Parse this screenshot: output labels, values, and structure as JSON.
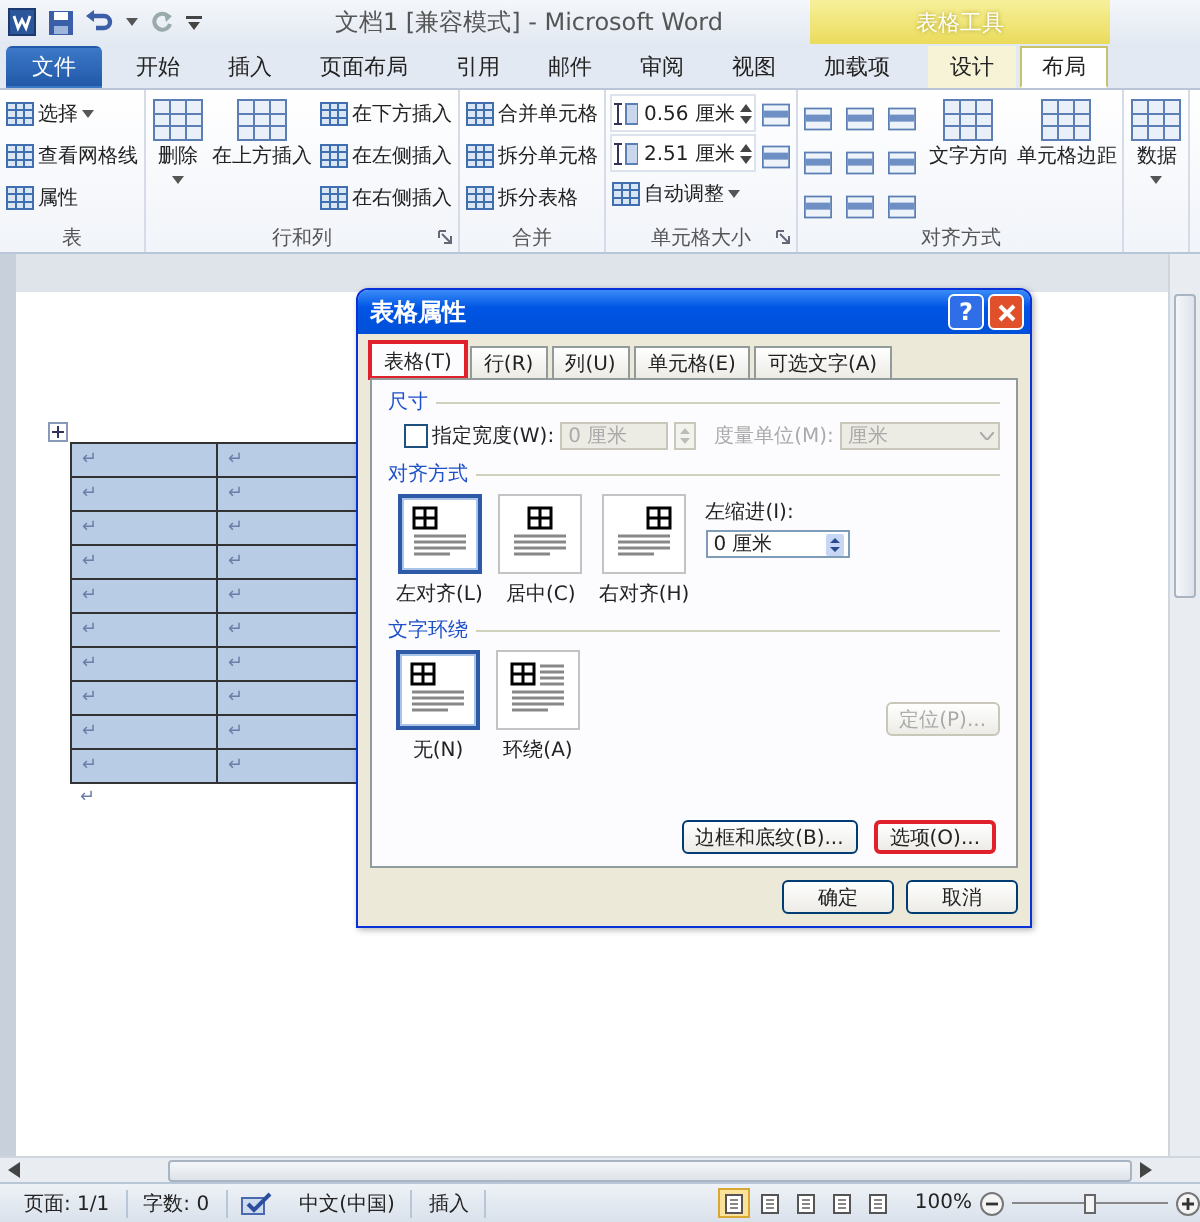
{
  "window": {
    "title": "文档1 [兼容模式] - Microsoft Word",
    "contextual_label": "表格工具"
  },
  "ribbon_tabs": [
    {
      "label": "文件",
      "kind": "file",
      "selected": false
    },
    {
      "label": "开始",
      "kind": "normal",
      "selected": false
    },
    {
      "label": "插入",
      "kind": "normal",
      "selected": false
    },
    {
      "label": "页面布局",
      "kind": "normal",
      "selected": false
    },
    {
      "label": "引用",
      "kind": "normal",
      "selected": false
    },
    {
      "label": "邮件",
      "kind": "normal",
      "selected": false
    },
    {
      "label": "审阅",
      "kind": "normal",
      "selected": false
    },
    {
      "label": "视图",
      "kind": "normal",
      "selected": false
    },
    {
      "label": "加载项",
      "kind": "normal",
      "selected": false
    },
    {
      "label": "设计",
      "kind": "contextual",
      "selected": false
    },
    {
      "label": "布局",
      "kind": "contextual",
      "selected": true
    }
  ],
  "ribbon_groups": [
    {
      "title": "表",
      "columns": [
        {
          "kind": "stack",
          "items": [
            {
              "kind": "small",
              "label": "选择",
              "dropdown": true
            },
            {
              "kind": "small",
              "label": "查看网格线"
            },
            {
              "kind": "small",
              "label": "属性"
            }
          ]
        }
      ]
    },
    {
      "title": "行和列",
      "launcher": true,
      "columns": [
        {
          "kind": "stack",
          "items": [
            {
              "kind": "large",
              "label": "删除",
              "dropdown": true
            }
          ]
        },
        {
          "kind": "stack",
          "items": [
            {
              "kind": "large",
              "label": "在上方插入"
            }
          ]
        },
        {
          "kind": "stack",
          "items": [
            {
              "kind": "small",
              "label": "在下方插入"
            },
            {
              "kind": "small",
              "label": "在左侧插入"
            },
            {
              "kind": "small",
              "label": "在右侧插入"
            }
          ]
        }
      ]
    },
    {
      "title": "合并",
      "columns": [
        {
          "kind": "stack",
          "items": [
            {
              "kind": "small",
              "label": "合并单元格"
            },
            {
              "kind": "small",
              "label": "拆分单元格"
            },
            {
              "kind": "small",
              "label": "拆分表格"
            }
          ]
        }
      ]
    },
    {
      "title": "单元格大小",
      "launcher": true,
      "columns": [
        {
          "kind": "stack",
          "items": [
            {
              "kind": "spin",
              "value": "0.56 厘米"
            },
            {
              "kind": "spin",
              "value": "2.51 厘米"
            },
            {
              "kind": "small",
              "label": "自动调整",
              "dropdown": true
            }
          ]
        },
        {
          "kind": "stack",
          "items": [
            {
              "kind": "icon"
            },
            {
              "kind": "icon"
            }
          ]
        }
      ]
    },
    {
      "title": "对齐方式",
      "columns": [
        {
          "kind": "align-grid",
          "items": [
            {
              "kind": "icon"
            },
            {
              "kind": "icon"
            },
            {
              "kind": "icon"
            },
            {
              "kind": "icon"
            },
            {
              "kind": "icon"
            },
            {
              "kind": "icon"
            },
            {
              "kind": "icon"
            },
            {
              "kind": "icon"
            },
            {
              "kind": "icon"
            }
          ]
        },
        {
          "kind": "stack",
          "items": [
            {
              "kind": "large",
              "label": "文字方向"
            }
          ]
        },
        {
          "kind": "stack",
          "items": [
            {
              "kind": "large",
              "label": "单元格边距"
            }
          ]
        }
      ]
    },
    {
      "columns": [
        {
          "kind": "stack",
          "items": [
            {
              "kind": "large",
              "label": "数据",
              "dropdown": true
            }
          ]
        }
      ]
    }
  ],
  "document": {
    "table": {
      "selected": true,
      "rows": [
        [
          "↵",
          "↵"
        ],
        [
          "↵",
          "↵"
        ],
        [
          "↵",
          "↵"
        ],
        [
          "↵",
          "↵"
        ],
        [
          "↵",
          "↵"
        ],
        [
          "↵",
          "↵"
        ],
        [
          "↵",
          "↵"
        ],
        [
          "↵",
          "↵"
        ],
        [
          "↵",
          "↵"
        ],
        [
          "↵",
          "↵"
        ]
      ]
    },
    "paragraph_mark": "↵"
  },
  "dialog": {
    "title": "表格属性",
    "help": "?",
    "tabs": [
      {
        "label": "表格(T)",
        "selected": true,
        "highlighted": true
      },
      {
        "label": "行(R)",
        "selected": false,
        "highlighted": false
      },
      {
        "label": "列(U)",
        "selected": false,
        "highlighted": false
      },
      {
        "label": "单元格(E)",
        "selected": false,
        "highlighted": false
      },
      {
        "label": "可选文字(A)",
        "selected": false,
        "highlighted": false
      }
    ],
    "size": {
      "heading": "尺寸",
      "width_checkbox": {
        "label": "指定宽度(W):",
        "checked": false
      },
      "width_field": {
        "value": "0 厘米",
        "disabled": true
      },
      "unit_label": "度量单位(M):",
      "unit_field": {
        "value": "厘米",
        "disabled": true
      }
    },
    "alignment": {
      "heading": "对齐方式",
      "options": [
        {
          "kind": "left",
          "label": "左对齐(L)",
          "selected": true
        },
        {
          "kind": "center",
          "label": "居中(C)",
          "selected": false
        },
        {
          "kind": "right",
          "label": "右对齐(H)",
          "selected": false
        }
      ],
      "indent_label": "左缩进(I):",
      "indent_field": {
        "value": "0 厘米"
      }
    },
    "wrapping": {
      "heading": "文字环绕",
      "options": [
        {
          "kind": "none",
          "label": "无(N)",
          "selected": true
        },
        {
          "kind": "around",
          "label": "环绕(A)",
          "selected": false
        }
      ],
      "position_button": {
        "label": "定位(P)...",
        "disabled": true
      }
    },
    "buttons": [
      {
        "label": "边框和底纹(B)...",
        "highlighted": false
      },
      {
        "label": "选项(O)...",
        "highlighted": true
      }
    ],
    "footer_buttons": [
      {
        "label": "确定"
      },
      {
        "label": "取消"
      }
    ]
  },
  "status_bar": {
    "page": "页面: 1/1",
    "words": "字数: 0",
    "language": "中文(中国)",
    "mode": "插入",
    "views": [
      {
        "selected": true
      },
      {
        "selected": false
      },
      {
        "selected": false
      },
      {
        "selected": false
      },
      {
        "selected": false
      }
    ],
    "zoom": "100%",
    "zoom_slider": {
      "level": 0.5
    }
  }
}
